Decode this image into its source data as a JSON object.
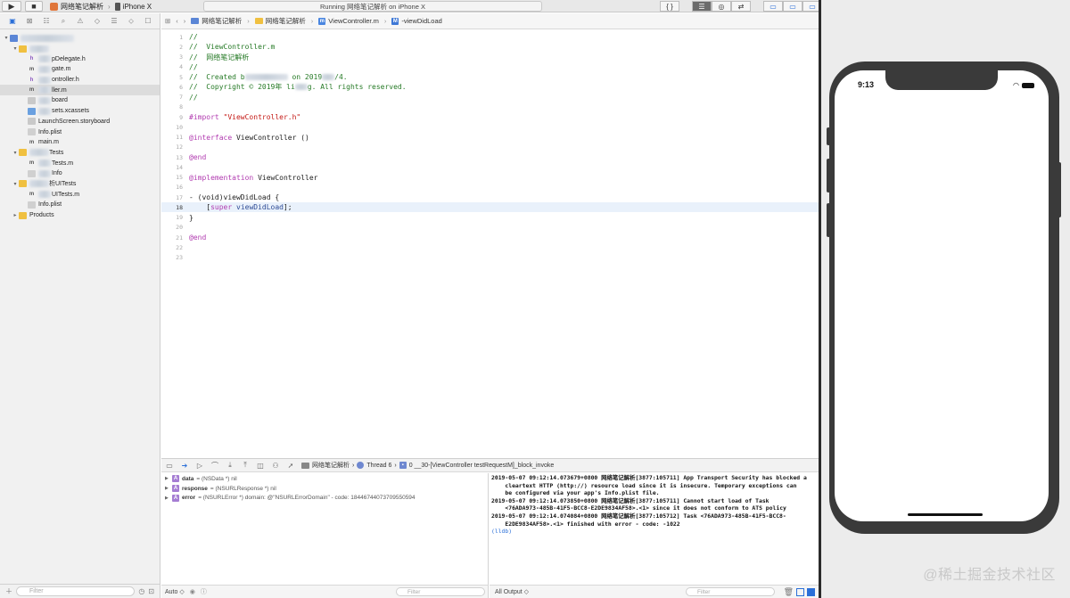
{
  "toolbar": {
    "run_icon": "▶",
    "stop_icon": "■",
    "scheme_target": "网络笔记解析",
    "scheme_separator": "›",
    "scheme_device": "iPhone X",
    "activity_status": "Running 网络笔记解析 on iPhone X",
    "editor_modes": [
      "{ }",
      "☰",
      "◎",
      "⇄"
    ],
    "layout_buttons": [
      "▭",
      "▭",
      "▭"
    ]
  },
  "navigator": {
    "tabs": [
      "folder-icon",
      "source-control-icon",
      "symbol-icon",
      "find-icon",
      "issue-icon",
      "test-icon",
      "debug-icon",
      "breakpoint-icon",
      "report-icon"
    ],
    "items": [
      {
        "label": "",
        "type": "proj",
        "indent": 0,
        "disc": "▾"
      },
      {
        "label": "",
        "type": "folder",
        "indent": 1,
        "disc": "▾"
      },
      {
        "label": "pDelegate.h",
        "type": "h",
        "indent": 2,
        "disc": ""
      },
      {
        "label": "gate.m",
        "type": "m",
        "indent": 2,
        "disc": ""
      },
      {
        "label": "ontroller.h",
        "type": "h",
        "indent": 2,
        "disc": ""
      },
      {
        "label": "ller.m",
        "type": "m",
        "indent": 2,
        "disc": "",
        "selected": true
      },
      {
        "label": "board",
        "type": "sb",
        "indent": 2,
        "disc": ""
      },
      {
        "label": "sets.xcassets",
        "type": "assets",
        "indent": 2,
        "disc": ""
      },
      {
        "label": "LaunchScreen.storyboard",
        "type": "sb",
        "indent": 2,
        "disc": ""
      },
      {
        "label": "Info.plist",
        "type": "plist",
        "indent": 2,
        "disc": ""
      },
      {
        "label": "main.m",
        "type": "m",
        "indent": 2,
        "disc": ""
      },
      {
        "label": "Tests",
        "type": "folder",
        "indent": 1,
        "disc": "▾"
      },
      {
        "label": "Tests.m",
        "type": "m",
        "indent": 2,
        "disc": ""
      },
      {
        "label": "Info",
        "type": "plist",
        "indent": 2,
        "disc": ""
      },
      {
        "label": "析UITests",
        "type": "folder",
        "indent": 1,
        "disc": "▾"
      },
      {
        "label": "UITests.m",
        "type": "m",
        "indent": 2,
        "disc": ""
      },
      {
        "label": "Info.plist",
        "type": "plist",
        "indent": 2,
        "disc": ""
      },
      {
        "label": "Products",
        "type": "folder",
        "indent": 1,
        "disc": "▸"
      }
    ],
    "filter_placeholder": "Filter"
  },
  "jumpbar": {
    "crumbs": [
      "网络笔记解析",
      "网络笔记解析",
      "ViewController.m",
      "-viewDidLoad"
    ]
  },
  "editor": {
    "current_line": 18,
    "lines": [
      [
        {
          "t": "//",
          "c": "comment"
        }
      ],
      [
        {
          "t": "//  ViewController.m",
          "c": "comment"
        }
      ],
      [
        {
          "t": "//  网络笔记解析",
          "c": "comment"
        }
      ],
      [
        {
          "t": "//",
          "c": "comment"
        }
      ],
      [
        {
          "t": "//  Created b",
          "c": "comment"
        },
        {
          "t": "",
          "c": "blur"
        },
        {
          "t": " on 2019",
          "c": "comment"
        },
        {
          "t": "",
          "c": "blur-s"
        },
        {
          "t": "/4.",
          "c": "comment"
        }
      ],
      [
        {
          "t": "//  Copyright © 2019年 li",
          "c": "comment"
        },
        {
          "t": "",
          "c": "blur-s"
        },
        {
          "t": "g. All rights reserved.",
          "c": "comment"
        }
      ],
      [
        {
          "t": "//",
          "c": "comment"
        }
      ],
      [],
      [
        {
          "t": "#import ",
          "c": "keyword"
        },
        {
          "t": "\"ViewController.h\"",
          "c": "string"
        }
      ],
      [],
      [
        {
          "t": "@interface ",
          "c": "keyword"
        },
        {
          "t": "ViewController ()",
          "c": "plain"
        }
      ],
      [],
      [
        {
          "t": "@end",
          "c": "keyword"
        }
      ],
      [],
      [
        {
          "t": "@implementation ",
          "c": "keyword"
        },
        {
          "t": "ViewController",
          "c": "plain"
        }
      ],
      [],
      [
        {
          "t": "- (void)viewDidLoad {",
          "c": "plain"
        }
      ],
      [
        {
          "t": "    [",
          "c": "plain"
        },
        {
          "t": "super ",
          "c": "keyword"
        },
        {
          "t": "viewDidLoad",
          "c": "method"
        },
        {
          "t": "];",
          "c": "plain"
        }
      ],
      [
        {
          "t": "}",
          "c": "plain"
        }
      ],
      [],
      [
        {
          "t": "@end",
          "c": "keyword"
        }
      ],
      [],
      []
    ]
  },
  "debugbar": {
    "thread_path": [
      "网络笔记解析",
      "Thread 6",
      "0 __30-[ViewController testRequestM]_block_invoke"
    ]
  },
  "variables": [
    {
      "name": "data",
      "value": "= (NSData *) nil"
    },
    {
      "name": "response",
      "value": "= (NSURLResponse *) nil"
    },
    {
      "name": "error",
      "value": "= (NSURLError *) domain: @\"NSURLErrorDomain\" - code: 18446744073709550594"
    }
  ],
  "variables_footer": {
    "scope": "Auto ◇",
    "filter_placeholder": "Filter"
  },
  "console": {
    "lines": [
      "2019-05-07 09:12:14.073679+0800 网络笔记解析[3877:105711] App Transport Security has blocked a",
      "    cleartext HTTP (http://) resource load since it is insecure. Temporary exceptions can",
      "    be configured via your app's Info.plist file.",
      "2019-05-07 09:12:14.073850+0800 网络笔记解析[3877:105711] Cannot start load of Task",
      "    <76ADA973-485B-41F5-BCC8-E2DE9834AF58>.<1> since it does not conform to ATS policy",
      "2019-05-07 09:12:14.074084+0800 网络笔记解析[3877:105712] Task <76ADA973-485B-41F5-BCC8-",
      "    E2DE9834AF58>.<1> finished with error - code: -1022"
    ],
    "prompt": "(lldb)"
  },
  "console_footer": {
    "output": "All Output ◇",
    "filter_placeholder": "Filter"
  },
  "simulator": {
    "time": "9:13"
  },
  "watermark": "@稀土掘金技术社区"
}
